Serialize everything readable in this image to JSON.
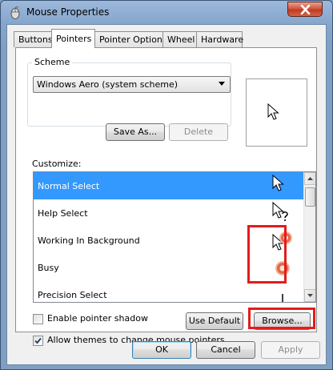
{
  "window": {
    "title": "Mouse Properties",
    "close_label": "close"
  },
  "tabs": [
    {
      "label": "Buttons",
      "active": false
    },
    {
      "label": "Pointers",
      "active": true
    },
    {
      "label": "Pointer Options",
      "active": false
    },
    {
      "label": "Wheel",
      "active": false
    },
    {
      "label": "Hardware",
      "active": false
    }
  ],
  "scheme": {
    "label": "Scheme",
    "selected": "Windows Aero (system scheme)",
    "save_as_label": "Save As...",
    "delete_label": "Delete"
  },
  "customize": {
    "label": "Customize:",
    "rows": [
      {
        "label": "Normal Select",
        "icon": "arrow-cursor-icon",
        "selected": true
      },
      {
        "label": "Help Select",
        "icon": "help-cursor-icon",
        "selected": false
      },
      {
        "label": "Working In Background",
        "icon": "busy-arrow-cursor-icon",
        "selected": false
      },
      {
        "label": "Busy",
        "icon": "busy-ring-cursor-icon",
        "selected": false
      },
      {
        "label": "Precision Select",
        "icon": "crosshair-cursor-icon",
        "selected": false
      }
    ]
  },
  "options": {
    "enable_shadow_label": "Enable pointer shadow",
    "enable_shadow_checked": false,
    "allow_themes_label": "Allow themes to change mouse pointers",
    "allow_themes_checked": true
  },
  "buttons": {
    "use_default_label": "Use Default",
    "browse_label": "Browse...",
    "ok_label": "OK",
    "cancel_label": "Cancel",
    "apply_label": "Apply"
  },
  "colors": {
    "selection": "#3399ff",
    "highlight": "#e41b1b",
    "title_bar": "#7f9fc3",
    "close_button": "#c03a22"
  }
}
